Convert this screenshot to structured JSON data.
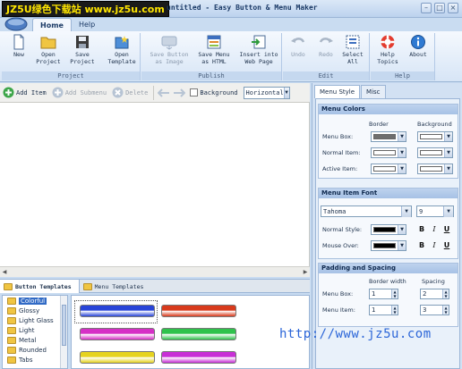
{
  "watermark": {
    "text": "JZ5U绿色下载站 www.jz5u.com"
  },
  "window": {
    "title": "untitled - Easy Button & Menu Maker"
  },
  "ribbon_tabs": [
    {
      "label": "Home"
    },
    {
      "label": "Help"
    }
  ],
  "ribbon_groups": {
    "project": {
      "label": "Project",
      "buttons": [
        "New",
        "Open\nProject",
        "Save\nProject",
        "Open\nTemplate"
      ]
    },
    "publish": {
      "label": "Publish",
      "buttons": [
        "Save Button\nas Image",
        "Save Menu\nas HTML",
        "Insert into\nWeb Page"
      ]
    },
    "edit": {
      "label": "Edit",
      "buttons": [
        "Undo",
        "Redo",
        "Select\nAll"
      ]
    },
    "help": {
      "label": "Help",
      "buttons": [
        "Help\nTopics",
        "About"
      ]
    }
  },
  "toolbar": {
    "add_item": "Add Item",
    "add_subitem": "Add Submenu",
    "delete": "Delete",
    "background": "Background",
    "orientation": "Horizontal"
  },
  "bottom_tabs": [
    {
      "label": "Button Templates"
    },
    {
      "label": "Menu Templates"
    }
  ],
  "template_tree": [
    {
      "label": "Colorful",
      "selected": true
    },
    {
      "label": "Glossy"
    },
    {
      "label": "Light Glass"
    },
    {
      "label": "Light"
    },
    {
      "label": "Metal"
    },
    {
      "label": "Rounded"
    },
    {
      "label": "Tabs"
    }
  ],
  "swatch_colors": [
    "#2844d8",
    "#d83a1c",
    "#d62fc6",
    "#2fc24c",
    "#e6d31e",
    "#c82fd6"
  ],
  "right_panel": {
    "tabs": [
      {
        "label": "Menu Style"
      },
      {
        "label": "Misc"
      }
    ],
    "menu_colors": {
      "title": "Menu Colors",
      "col_border": "Border",
      "col_background": "Background",
      "rows": [
        {
          "label": "Menu Box:",
          "border": "#6e6e6e",
          "background": "#ffffff"
        },
        {
          "label": "Normal Item:",
          "border": "#ffffff",
          "background": "#ffffff"
        },
        {
          "label": "Active Item:",
          "border": "#ffffff",
          "background": "#ffffff"
        }
      ]
    },
    "item_font": {
      "title": "Menu Item Font",
      "font": "Tahoma",
      "size": "9",
      "normal_style": "Normal Style:",
      "mouse_over": "Mouse Over:",
      "bold": "B",
      "italic": "I",
      "underline": "U"
    },
    "padding": {
      "title": "Padding and Spacing",
      "col_border_width": "Border width",
      "col_spacing": "Spacing",
      "rows": [
        {
          "label": "Menu Box:",
          "border_width": "1",
          "spacing": "2"
        },
        {
          "label": "Menu Item:",
          "border_width": "1",
          "spacing": "3"
        }
      ]
    }
  },
  "url_watermark": "http://www.jz5u.com"
}
